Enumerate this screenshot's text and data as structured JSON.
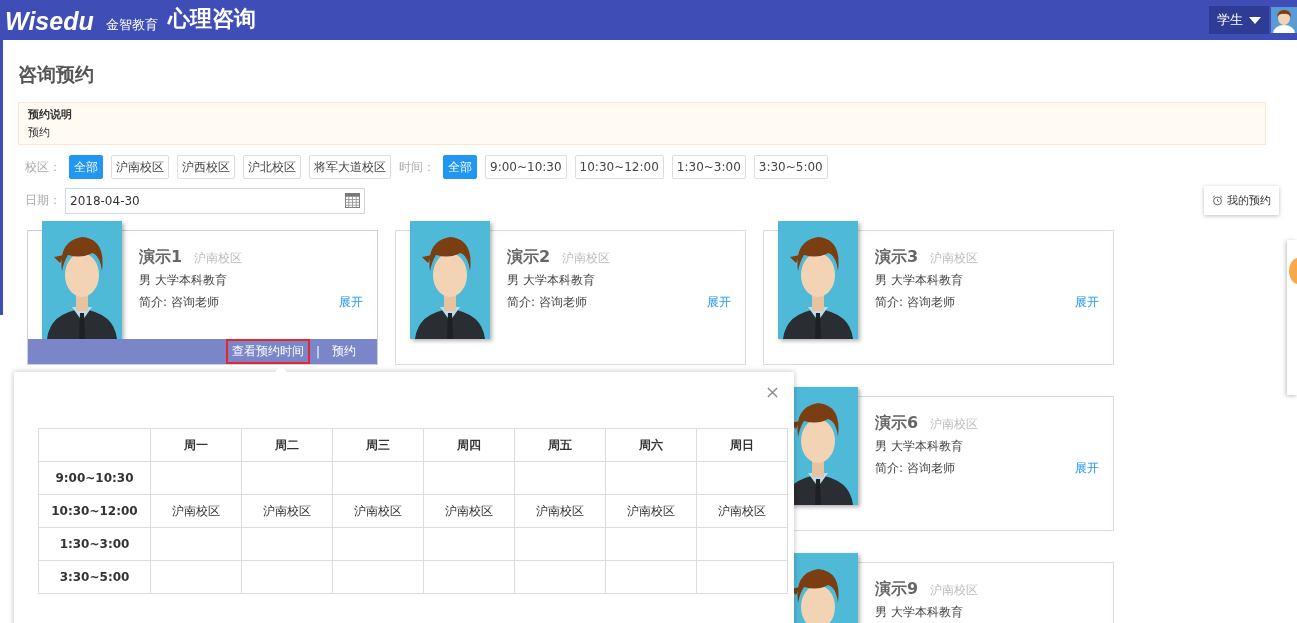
{
  "header": {
    "logo": "Wisedu",
    "logo_sub": "金智教育",
    "title": "心理咨询",
    "role": "学生"
  },
  "page_title": "咨询预约",
  "notice": {
    "title": "预约说明",
    "text": "预约"
  },
  "campus_filter": {
    "label": "校区：",
    "options": [
      {
        "label": "全部",
        "selected": true
      },
      {
        "label": "沪南校区",
        "selected": false
      },
      {
        "label": "沪西校区",
        "selected": false
      },
      {
        "label": "沪北校区",
        "selected": false
      },
      {
        "label": "将军大道校区",
        "selected": false
      }
    ]
  },
  "time_filter": {
    "label": "时间：",
    "options": [
      {
        "label": "全部",
        "selected": true
      },
      {
        "label": "9:00~10:30",
        "selected": false
      },
      {
        "label": "10:30~12:00",
        "selected": false
      },
      {
        "label": "1:30~3:00",
        "selected": false
      },
      {
        "label": "3:30~5:00",
        "selected": false
      }
    ]
  },
  "date": {
    "label": "日期：",
    "value": "2018-04-30"
  },
  "my_booking": "我的预约",
  "counselors": [
    {
      "name": "演示1",
      "campus": "沪南校区",
      "info": "男 大学本科教育",
      "intro": "简介: 咨询老师",
      "expand": "展开",
      "hovered": true,
      "actions": [
        {
          "label": "查看预约时间",
          "highlighted": true
        },
        {
          "label": "预约",
          "highlighted": false
        }
      ],
      "separator": "|"
    },
    {
      "name": "演示2",
      "campus": "沪南校区",
      "info": "男 大学本科教育",
      "intro": "简介: 咨询老师",
      "expand": "展开",
      "hovered": false
    },
    {
      "name": "演示3",
      "campus": "沪南校区",
      "info": "男 大学本科教育",
      "intro": "简介: 咨询老师",
      "expand": "展开",
      "hovered": false
    },
    {
      "name": "演示6",
      "campus": "沪南校区",
      "info": "男 大学本科教育",
      "intro": "简介: 咨询老师",
      "expand": "展开",
      "hovered": false
    },
    {
      "name": "演示9",
      "campus": "沪南校区",
      "info": "男 大学本科教育",
      "hovered": false
    }
  ],
  "schedule_popup": {
    "columns": [
      "周一",
      "周二",
      "周三",
      "周四",
      "周五",
      "周六",
      "周日"
    ],
    "rows": [
      {
        "time": "9:00~10:30",
        "cells": [
          "",
          "",
          "",
          "",
          "",
          "",
          ""
        ]
      },
      {
        "time": "10:30~12:00",
        "cells": [
          "沪南校区",
          "沪南校区",
          "沪南校区",
          "沪南校区",
          "沪南校区",
          "沪南校区",
          "沪南校区"
        ]
      },
      {
        "time": "1:30~3:00",
        "cells": [
          "",
          "",
          "",
          "",
          "",
          "",
          ""
        ]
      },
      {
        "time": "3:30~5:00",
        "cells": [
          "",
          "",
          "",
          "",
          "",
          "",
          ""
        ]
      }
    ]
  }
}
